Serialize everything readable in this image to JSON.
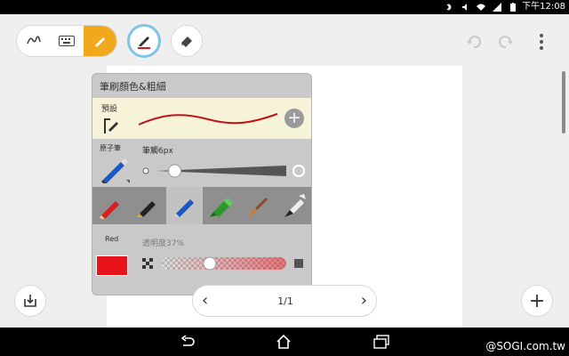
{
  "status_bar": {
    "time": "下午12:08",
    "icons": [
      "bluetooth-icon",
      "mute-icon",
      "wifi-icon",
      "signal-icon",
      "battery-icon"
    ]
  },
  "toolbar": {
    "modes": [
      "handwriting-icon",
      "keyboard-icon",
      "brush-icon"
    ],
    "active_mode": "brush-icon",
    "pen_tool_icon": "pen-icon",
    "eraser_tool_icon": "eraser-icon",
    "undo_icon": "undo-icon",
    "redo_icon": "redo-icon",
    "more_icon": "more-vert-icon"
  },
  "brush_popup": {
    "title": "筆刷顏色&粗細",
    "preset": {
      "label": "預設",
      "add_symbol": "+"
    },
    "pen": {
      "label": "原子筆",
      "size_label": "筆觸6px",
      "size_level": 0.1
    },
    "pen_types": [
      "red-pencil-icon",
      "fountain-pen-icon",
      "ballpoint-pen-icon",
      "highlighter-icon",
      "paint-brush-icon",
      "calligraphy-brush-icon"
    ],
    "selected_pen_type": 2,
    "color": {
      "name": "Red",
      "hex": "#e8121a",
      "opacity_label": "透明度37%",
      "opacity": 0.37
    }
  },
  "pager": {
    "prev": "‹",
    "page": "1/1",
    "next": "›"
  },
  "add_page": "+",
  "watermark": "@SOGI.com.tw",
  "colors": {
    "accent_orange": "#f2a81d",
    "accent_blue_ring": "#7fc4e8",
    "preset_bg": "#f6f3d8",
    "stroke_red": "#c0121a"
  }
}
